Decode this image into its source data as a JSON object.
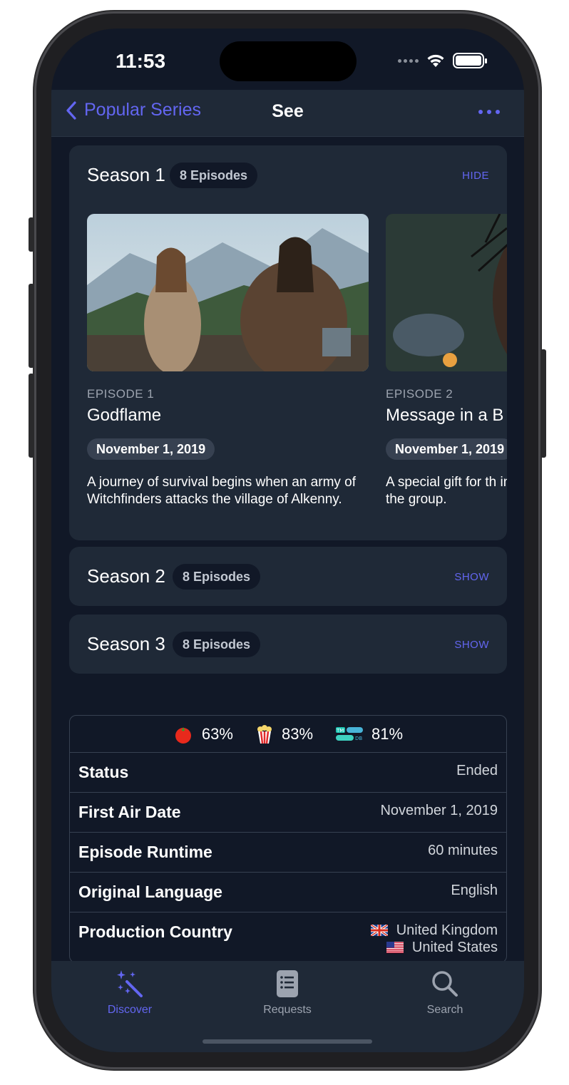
{
  "status_bar": {
    "time": "11:53"
  },
  "nav": {
    "back_label": "Popular Series",
    "title": "See"
  },
  "seasons": [
    {
      "title": "Season 1",
      "episodes_badge": "8 Episodes",
      "toggle": "HIDE",
      "episodes": [
        {
          "label": "EPISODE 1",
          "name": "Godflame",
          "date": "November 1, 2019",
          "description": "A journey of survival begins when an army of Witchfinders attacks the village of Alkenny."
        },
        {
          "label": "EPISODE 2",
          "name": "Message in a B",
          "date": "November 1, 2019",
          "description": "A special gift for th in the group."
        }
      ]
    },
    {
      "title": "Season 2",
      "episodes_badge": "8 Episodes",
      "toggle": "SHOW"
    },
    {
      "title": "Season 3",
      "episodes_badge": "8 Episodes",
      "toggle": "SHOW"
    }
  ],
  "ratings": {
    "rotten_tomatoes": "63%",
    "audience": "83%",
    "tmdb": "81%",
    "tmdb_logo_top": "TM",
    "tmdb_logo_bottom": "DB"
  },
  "details": {
    "status_label": "Status",
    "status_value": "Ended",
    "air_date_label": "First Air Date",
    "air_date_value": "November 1, 2019",
    "runtime_label": "Episode Runtime",
    "runtime_value": "60 minutes",
    "language_label": "Original Language",
    "language_value": "English",
    "country_label": "Production Country",
    "countries": [
      "United Kingdom",
      "United States"
    ]
  },
  "tabbar": {
    "discover": "Discover",
    "requests": "Requests",
    "search": "Search"
  },
  "colors": {
    "accent": "#6366f1",
    "background": "#111827",
    "card": "#1f2937"
  }
}
